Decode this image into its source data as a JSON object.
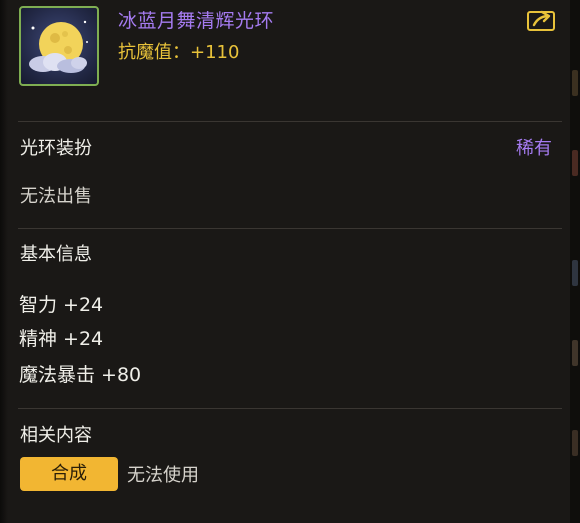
{
  "item": {
    "name": "冰蓝月舞清辉光环",
    "stat": "抗魔值：+110",
    "icon": "moon-cloud-icon",
    "share_icon": "share-icon"
  },
  "type_section": {
    "category": "光环装扮",
    "rarity": "稀有",
    "trade": "无法出售"
  },
  "basic_info": {
    "title": "基本信息",
    "attributes": [
      "智力 +24",
      "精神 +24",
      "魔法暴击 +80"
    ]
  },
  "related": {
    "title": "相关内容",
    "craft_label": "合成",
    "craft_status": "无法使用"
  },
  "colors": {
    "rarity": "#a57bf0",
    "stat": "#e8c23a",
    "button": "#f2b632",
    "icon_border": "#7fae52"
  }
}
